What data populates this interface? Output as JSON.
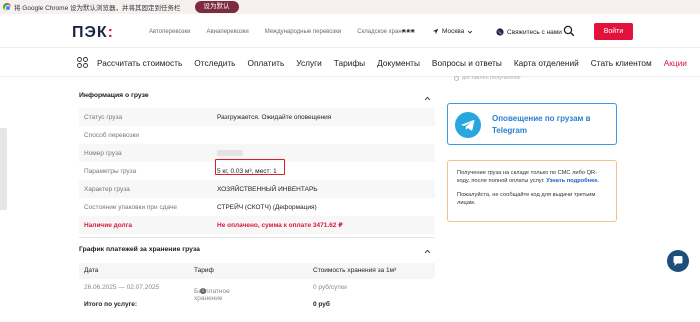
{
  "infobar": {
    "message": "将 Google Chrome 设为默认浏览器，并将其固定到任务栏",
    "button_label": "设为默认"
  },
  "header": {
    "logo_main": "ПЭК",
    "logo_accent": ":",
    "nav_links": [
      "Автоперевозки",
      "Авиаперевозки",
      "Международные перевозки",
      "Складское хранение"
    ],
    "more": "•••",
    "city": "Москва",
    "contact": "Свяжитесь с нами",
    "login": "Войти"
  },
  "mainnav": {
    "items": [
      "Рассчитать стоимость",
      "Отследить",
      "Оплатить",
      "Услуги",
      "Тарифы",
      "Документы",
      "Вопросы и ответы",
      "Карта отделений",
      "Стать клиентом"
    ],
    "promo": "Акции"
  },
  "cargo_info": {
    "title": "Информация о грузе",
    "rows": [
      {
        "label": "Статус груза",
        "value": "Разгружается. Ожидайте оповещения"
      },
      {
        "label": "Способ перевозки",
        "value": ""
      },
      {
        "label": "Номер груза",
        "value": ""
      },
      {
        "label": "Параметры груза",
        "value": "5 кг, 0.03 м³, мест: 1"
      },
      {
        "label": "Характер груза",
        "value": "ХОЗЯЙСТВЕННЫЙ ИНВЕНТАРЬ"
      },
      {
        "label": "Состояние упаковки при сдаче",
        "value": "СТРЕЙЧ (СКОТЧ) (Деформация)"
      },
      {
        "label": "Наличие долга",
        "value": "Не оплачено, сумма к оплате 3471.62 ₽"
      }
    ]
  },
  "payment_schedule": {
    "title": "График платежей за хранение груза",
    "headers": [
      "Дата",
      "Тариф",
      "Стоимость хранения за 1м³"
    ],
    "rows": [
      {
        "date": "26.06.2025 — 02.07.2025",
        "tariff": "Бесплатное хранение",
        "cost": "0 руб/сутки"
      }
    ],
    "total_label": "Итого по услуге:",
    "total_value": "0 руб"
  },
  "sidebar": {
    "delivered_note": "доставлен получателю",
    "telegram_title": "Оповещение по грузам в Telegram",
    "sms_text": "Получение груза на складе только по СМС либо QR-коду, после полной оплаты услуг.",
    "sms_link": "Узнать подробнее.",
    "sms_note": "Пожалуйста, не сообщайте код для выдачи третьим лицам."
  },
  "colors": {
    "brand_red": "#e3123d",
    "brand_navy": "#1e2543",
    "telegram_blue": "#2aa6de",
    "highlight_red": "#d61f2b"
  }
}
